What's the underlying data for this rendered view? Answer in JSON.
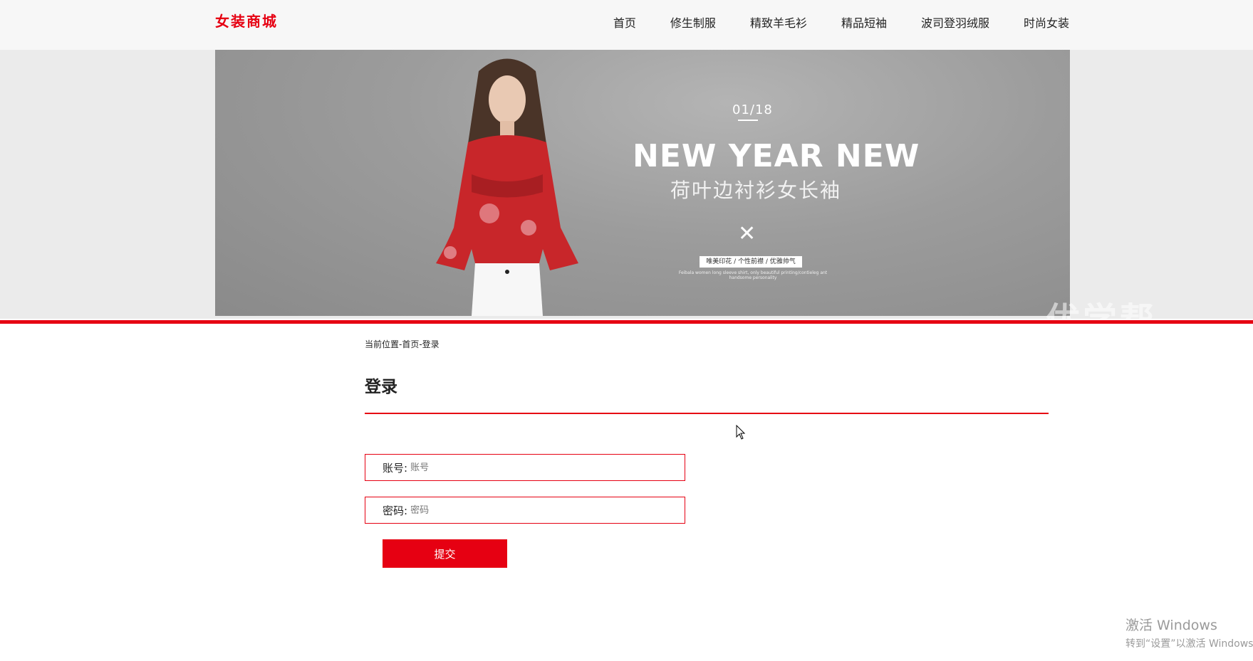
{
  "header": {
    "logo": "女装商城",
    "nav": [
      "首页",
      "修生制服",
      "精致羊毛衫",
      "精品短袖",
      "波司登羽绒服",
      "时尚女装"
    ]
  },
  "banner": {
    "date": "01/18",
    "title": "NEW YEAR NEW",
    "subtitle": "荷叶边衬衫女长袖",
    "tag": "唯美印花 / 个性前襟 / 优雅帅气",
    "small_text": "Feibala women long sleeve shirt, only beautiful printing/contieleg ant handsome personality",
    "watermark": "优学帮"
  },
  "breadcrumb": "当前位置-首页-登录",
  "page_title": "登录",
  "form": {
    "account_label": "账号:",
    "account_placeholder": "账号",
    "password_label": "密码:",
    "password_placeholder": "密码",
    "submit_label": "提交"
  },
  "system": {
    "activate_title": "激活 Windows",
    "activate_sub": "转到“设置”以激活 Windows。"
  },
  "colors": {
    "accent": "#e60012",
    "header_bg": "#f7f7f7",
    "banner_bg": "#9c9c9c"
  }
}
